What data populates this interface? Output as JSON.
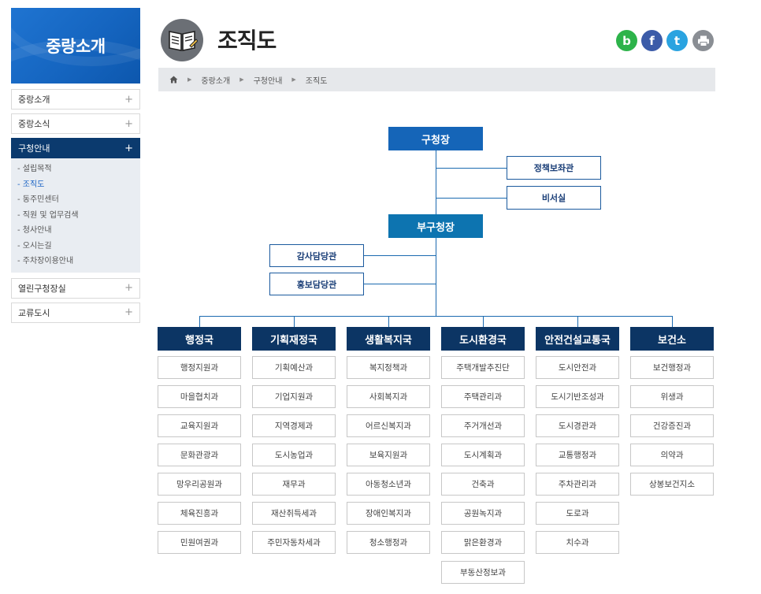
{
  "sidebar": {
    "title": "중랑소개",
    "menu": [
      {
        "label": "중랑소개",
        "icon": "plus-icon"
      },
      {
        "label": "중랑소식",
        "icon": "plus-icon"
      },
      {
        "label": "구청안내",
        "icon": "plus-icon",
        "active": true
      },
      {
        "label": "열린구청장실",
        "icon": "plus-icon"
      },
      {
        "label": "교류도시",
        "icon": "plus-icon"
      }
    ],
    "submenu": [
      "- 설립목적",
      "- 조직도",
      "- 동주민센터",
      "- 직원 및 업무검색",
      "- 청사안내",
      "- 오시는길",
      "- 주차장이용안내"
    ]
  },
  "header": {
    "title": "조직도",
    "icon": "book-icon",
    "share": [
      "b",
      "f",
      "t",
      "print-icon"
    ]
  },
  "breadcrumb": {
    "home_icon": "home-icon",
    "items": [
      "중랑소개",
      "구청안내",
      "조직도"
    ]
  },
  "org": {
    "mayor": "구청장",
    "policy_advisor": "정책보좌관",
    "secretary": "비서실",
    "deputy": "부구청장",
    "audit": "감사담당관",
    "pr": "홍보담당관",
    "departments": [
      {
        "name": "행정국",
        "units": [
          "행정지원과",
          "마을협치과",
          "교육지원과",
          "문화관광과",
          "망우리공원과",
          "체육진흥과",
          "민원여권과"
        ]
      },
      {
        "name": "기획재정국",
        "units": [
          "기획예산과",
          "기업지원과",
          "지역경제과",
          "도시농업과",
          "재무과",
          "재산취득세과",
          "주민자동차세과"
        ]
      },
      {
        "name": "생활복지국",
        "units": [
          "복지정책과",
          "사회복지과",
          "어르신복지과",
          "보육지원과",
          "아동청소년과",
          "장애인복지과",
          "청소행정과"
        ]
      },
      {
        "name": "도시환경국",
        "units": [
          "주택개발추진단",
          "주택관리과",
          "주거개선과",
          "도시계획과",
          "건축과",
          "공원녹지과",
          "맑은환경과",
          "부동산정보과"
        ]
      },
      {
        "name": "안전건설교통국",
        "units": [
          "도시안전과",
          "도시기반조성과",
          "도시경관과",
          "교통행정과",
          "주차관리과",
          "도로과",
          "치수과"
        ]
      },
      {
        "name": "보건소",
        "units": [
          "보건행정과",
          "위생과",
          "건강증진과",
          "의약과",
          "상봉보건지소"
        ]
      }
    ]
  },
  "colors": {
    "primary": "#1565b8",
    "navy": "#0c3564",
    "deputy": "#0d74b0",
    "line": "#1b6ab0"
  }
}
